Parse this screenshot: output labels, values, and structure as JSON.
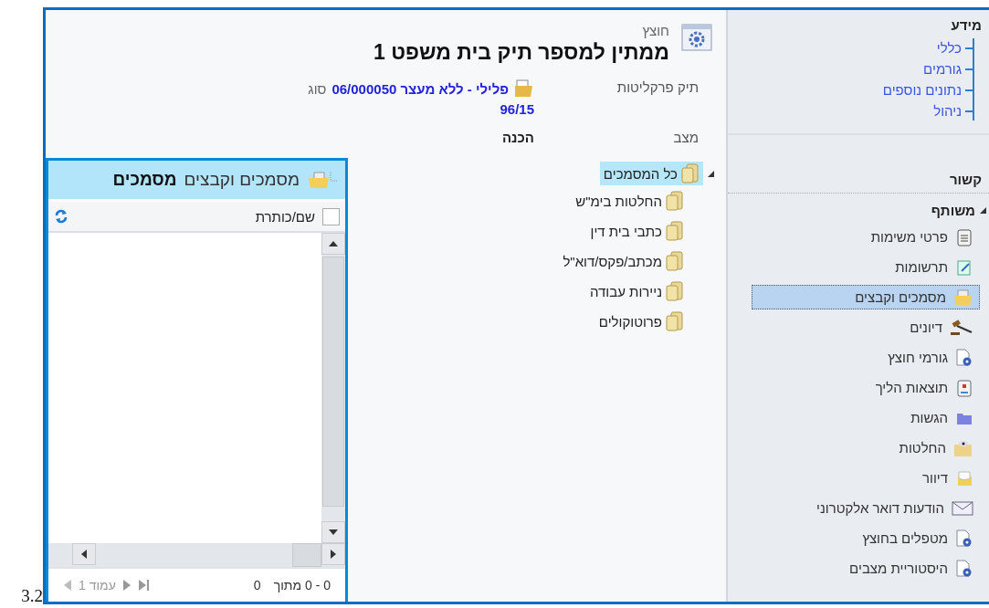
{
  "page_number": "3.2",
  "sidebar": {
    "info_title": "מידע",
    "info_links": [
      {
        "label": "כללי"
      },
      {
        "label": "גורמים"
      },
      {
        "label": "נתונים נוספים"
      },
      {
        "label": "ניהול"
      }
    ],
    "related_title": "קשור",
    "group": {
      "label": "משותף",
      "expanded": true
    },
    "items": [
      {
        "label": "פרטי משימות",
        "selected": false
      },
      {
        "label": "תרשומות",
        "selected": false
      },
      {
        "label": "מסמכים וקבצים",
        "selected": true
      },
      {
        "label": "דיונים",
        "selected": false
      },
      {
        "label": "גורמי חוצץ",
        "selected": false
      },
      {
        "label": "תוצאות הליך",
        "selected": false
      },
      {
        "label": "הגשות",
        "selected": false
      },
      {
        "label": "החלטות",
        "selected": false
      },
      {
        "label": "דיוור",
        "selected": false
      },
      {
        "label": "הודעות דואר אלקטרוני",
        "selected": false
      },
      {
        "label": "מטפלים בחוצץ",
        "selected": false
      },
      {
        "label": "היסטוריית מצבים",
        "selected": false
      }
    ]
  },
  "header": {
    "entity": "חוצץ",
    "title": "ממתין למספר תיק בית משפט 1",
    "case_file": {
      "label": "תיק פרקליטות",
      "link": "פלילי - ללא מעצר 06/000050",
      "suffix": "סוג",
      "link_2": "96/15"
    },
    "status": {
      "label": "מצב",
      "value": "הכנה"
    }
  },
  "tree": {
    "label": "כל המסמכים",
    "expanded": true,
    "selected": true,
    "children": [
      {
        "label": "החלטות בימ\"ש",
        "selected": false
      },
      {
        "label": "כתבי בית דין",
        "selected": false
      },
      {
        "label": "מכתב/פקס/דוא\"ל",
        "selected": false
      },
      {
        "label": "ניירות עבודה",
        "selected": false
      },
      {
        "label": "פרוטוקולים",
        "selected": false
      }
    ]
  },
  "documents_panel": {
    "title": "מסמכים וקבצים",
    "title_2": "מסמכים",
    "column": "שם/כותרת",
    "select_all_checked": false,
    "range": "0 - 0 מתוך",
    "total": "0",
    "page": "עמוד 1"
  }
}
